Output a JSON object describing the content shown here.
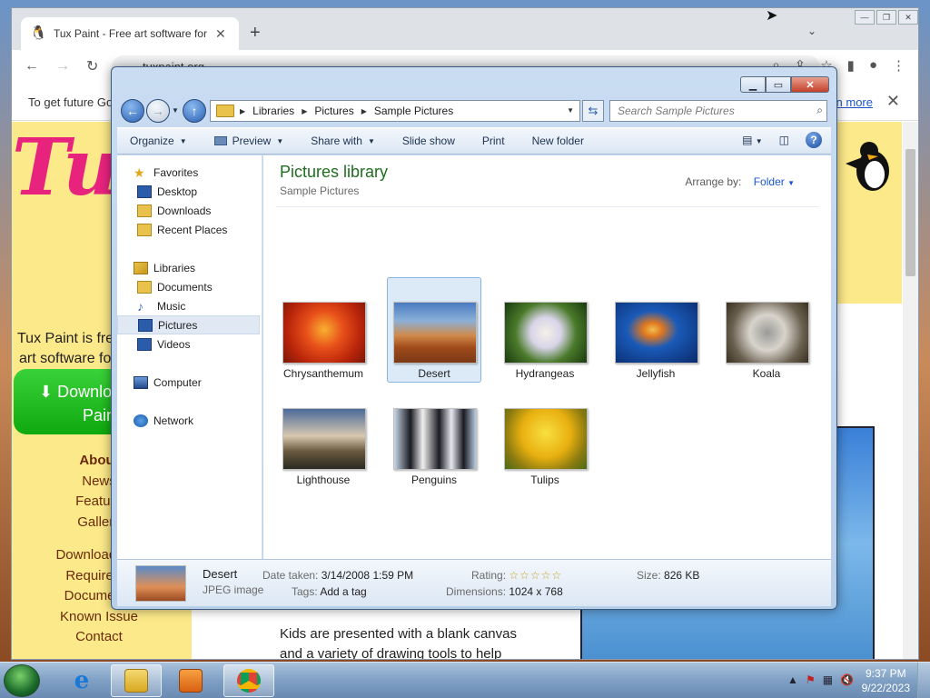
{
  "browser": {
    "tab_title": "Tux Paint - Free art software for ki",
    "url": "tuxpaint.org",
    "infobar_text": "To get future Go",
    "infobar_link": "rn more"
  },
  "tuxpage": {
    "logo": "Tux",
    "free_text_1": "Tux Paint is fre",
    "free_text_2": "art software fo",
    "download_1": "⬇ Downlo",
    "download_2": "Pain",
    "nav": [
      "About",
      "News",
      "Feature",
      "Gallery",
      "Download Tux",
      "Requireme",
      "Documenta",
      "Known Issue",
      "Contact"
    ],
    "body_line_1": "Kids are presented with a blank canvas",
    "body_line_2": "and a variety of drawing tools to help"
  },
  "explorer": {
    "breadcrumb": [
      "Libraries",
      "Pictures",
      "Sample Pictures"
    ],
    "search_placeholder": "Search Sample Pictures",
    "commands": [
      "Organize",
      "Preview",
      "Share with",
      "Slide show",
      "Print",
      "New folder"
    ],
    "nav_pane": {
      "favorites": "Favorites",
      "favorites_items": [
        "Desktop",
        "Downloads",
        "Recent Places"
      ],
      "libraries": "Libraries",
      "library_items": [
        "Documents",
        "Music",
        "Pictures",
        "Videos"
      ],
      "computer": "Computer",
      "network": "Network"
    },
    "library_title": "Pictures library",
    "library_subtitle": "Sample Pictures",
    "arrange_label": "Arrange by:",
    "arrange_value": "Folder",
    "files": [
      "Chrysanthemum",
      "Desert",
      "Hydrangeas",
      "Jellyfish",
      "Koala",
      "Lighthouse",
      "Penguins",
      "Tulips"
    ],
    "selected_file": "Desert",
    "details": {
      "name": "Desert",
      "type": "JPEG image",
      "date_label": "Date taken:",
      "date_value": "3/14/2008 1:59 PM",
      "tags_label": "Tags:",
      "tags_value": "Add a tag",
      "rating_label": "Rating:",
      "rating_stars": "☆☆☆☆☆",
      "dimensions_label": "Dimensions:",
      "dimensions_value": "1024 x 768",
      "size_label": "Size:",
      "size_value": "826 KB"
    }
  },
  "taskbar": {
    "time": "9:37 PM",
    "date": "9/22/2023"
  },
  "colors": {
    "library_title": "#1e6e1e",
    "link": "#1a56c8",
    "tux_pink": "#e8237e",
    "tux_yellow": "#fce98a"
  }
}
